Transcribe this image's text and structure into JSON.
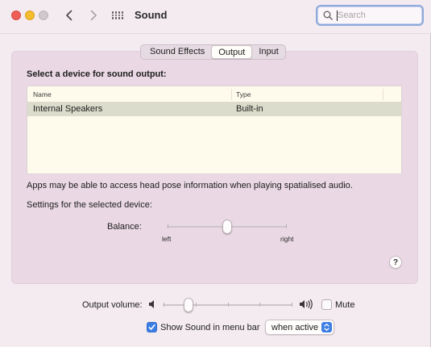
{
  "window": {
    "title": "Sound"
  },
  "search": {
    "placeholder": "Search",
    "value": ""
  },
  "tabs": [
    {
      "label": "Sound Effects",
      "active": false
    },
    {
      "label": "Output",
      "active": true
    },
    {
      "label": "Input",
      "active": false
    }
  ],
  "output": {
    "section_title": "Select a device for sound output:",
    "table": {
      "columns": [
        "Name",
        "Type"
      ],
      "rows": [
        {
          "name": "Internal Speakers",
          "type": "Built-in",
          "selected": true
        }
      ]
    },
    "info_text": "Apps may be able to access head pose information when playing spatialised audio.",
    "settings_label": "Settings for the selected device:",
    "balance": {
      "label": "Balance:",
      "left_label": "left",
      "right_label": "right",
      "value": 0.5
    },
    "help": "?"
  },
  "volume": {
    "label": "Output volume:",
    "value": 0.2,
    "mute_label": "Mute",
    "muted": false
  },
  "menu_bar": {
    "show_label": "Show Sound in menu bar",
    "checked": true,
    "popup_value": "when active"
  },
  "colors": {
    "accent": "#3d7ee3",
    "focus_ring": "#8fa9db",
    "close": "#ee5f57",
    "minimize": "#f5bd2e",
    "row_selected": "#dcdccc"
  }
}
